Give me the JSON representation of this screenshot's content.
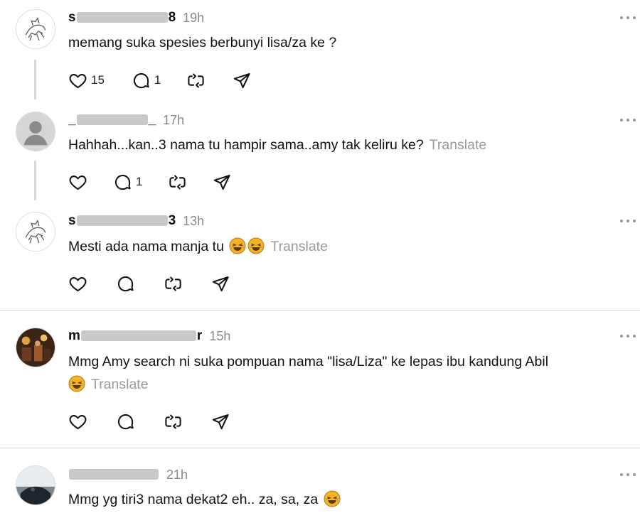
{
  "posts": [
    {
      "username_visible": "s",
      "username_end": "8",
      "time": "19h",
      "text": "memang suka spesies berbunyi lisa/za ke ?",
      "translate": "",
      "likes": "15",
      "replies": "1",
      "avatar": "sketch-avatar"
    },
    {
      "username_visible": "_",
      "username_end": "_",
      "time": "17h",
      "text": "Hahhah...kan..3 nama tu hampir sama..amy tak keliru ke?",
      "translate": "Translate",
      "likes": "",
      "replies": "1",
      "avatar": "default-avatar"
    },
    {
      "username_visible": "s",
      "username_end": "3",
      "time": "13h",
      "text": "Mesti ada nama manja tu",
      "translate": "Translate",
      "likes": "",
      "replies": "",
      "avatar": "sketch-avatar"
    },
    {
      "username_visible": "m",
      "username_end": "r",
      "time": "15h",
      "text": "Mmg Amy search ni suka pompuan nama \"lisa/Liza\" ke lepas ibu kandung Abil",
      "translate": "Translate",
      "likes": "",
      "replies": "",
      "avatar": "photo-avatar"
    },
    {
      "username_visible": "",
      "username_end": "",
      "time": "21h",
      "text": "Mmg yg tiri3 nama dekat2 eh.. za, sa, za",
      "translate": "",
      "likes": "",
      "replies": "",
      "avatar": "photo-avatar-dark"
    }
  ],
  "icons": {
    "like": "heart-icon",
    "reply": "comment-icon",
    "repost": "repost-icon",
    "share": "send-icon",
    "more": "more-options-icon",
    "emoji": "laughing-emoji"
  },
  "colors": {
    "muted": "#999999",
    "divider": "#d4d4d4",
    "emoji": "#f5b324"
  }
}
